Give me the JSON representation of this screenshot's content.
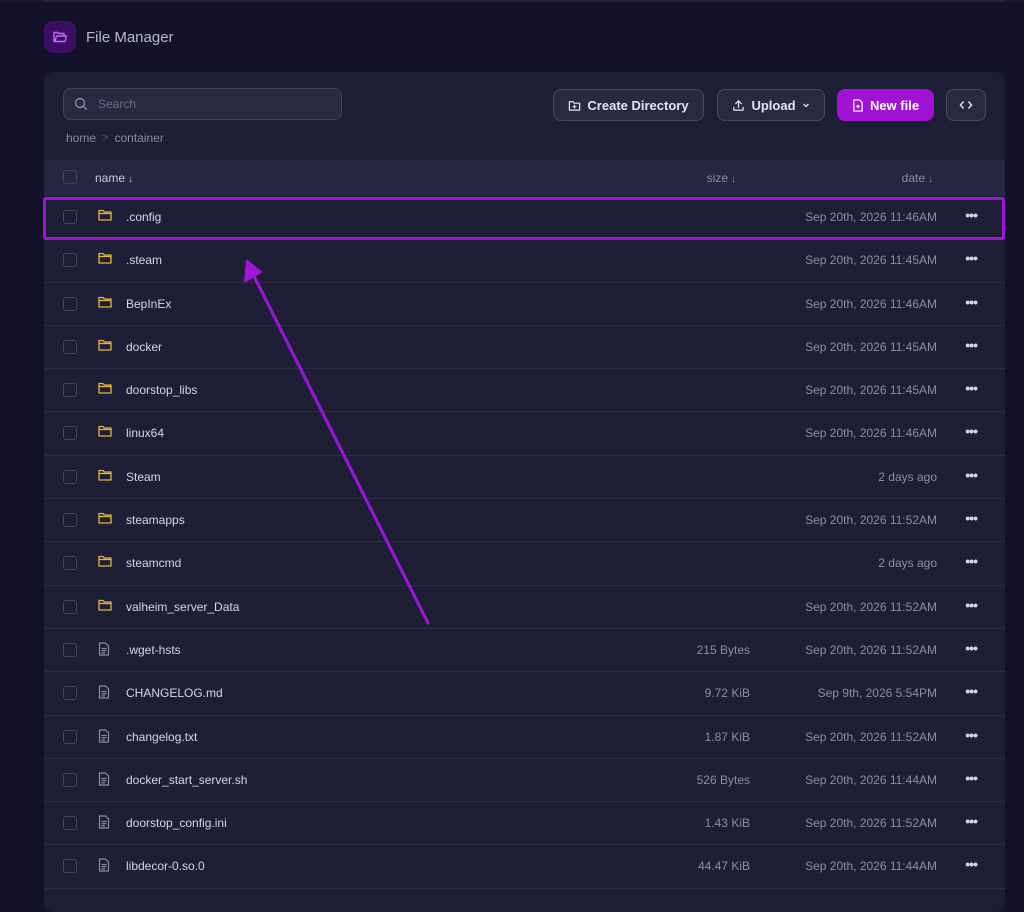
{
  "app": {
    "title": "File Manager"
  },
  "search": {
    "placeholder": "Search"
  },
  "toolbar": {
    "create_directory": "Create Directory",
    "upload": "Upload",
    "new_file": "New file"
  },
  "breadcrumb": [
    "home",
    "container"
  ],
  "columns": {
    "name": "name",
    "size": "size",
    "date": "date"
  },
  "sort_arrow": "↓",
  "files": [
    {
      "name": ".config",
      "type": "folder",
      "size": "",
      "date": "Sep 20th, 2026 11:46AM"
    },
    {
      "name": ".steam",
      "type": "folder",
      "size": "",
      "date": "Sep 20th, 2026 11:45AM"
    },
    {
      "name": "BepInEx",
      "type": "folder",
      "size": "",
      "date": "Sep 20th, 2026 11:46AM"
    },
    {
      "name": "docker",
      "type": "folder",
      "size": "",
      "date": "Sep 20th, 2026 11:45AM"
    },
    {
      "name": "doorstop_libs",
      "type": "folder",
      "size": "",
      "date": "Sep 20th, 2026 11:45AM"
    },
    {
      "name": "linux64",
      "type": "folder",
      "size": "",
      "date": "Sep 20th, 2026 11:46AM"
    },
    {
      "name": "Steam",
      "type": "folder",
      "size": "",
      "date": "2 days ago"
    },
    {
      "name": "steamapps",
      "type": "folder",
      "size": "",
      "date": "Sep 20th, 2026 11:52AM"
    },
    {
      "name": "steamcmd",
      "type": "folder",
      "size": "",
      "date": "2 days ago"
    },
    {
      "name": "valheim_server_Data",
      "type": "folder",
      "size": "",
      "date": "Sep 20th, 2026 11:52AM"
    },
    {
      "name": ".wget-hsts",
      "type": "file",
      "size": "215 Bytes",
      "date": "Sep 20th, 2026 11:52AM"
    },
    {
      "name": "CHANGELOG.md",
      "type": "file",
      "size": "9.72 KiB",
      "date": "Sep 9th, 2026 5:54PM"
    },
    {
      "name": "changelog.txt",
      "type": "file",
      "size": "1.87 KiB",
      "date": "Sep 20th, 2026 11:52AM"
    },
    {
      "name": "docker_start_server.sh",
      "type": "file",
      "size": "526 Bytes",
      "date": "Sep 20th, 2026 11:44AM"
    },
    {
      "name": "doorstop_config.ini",
      "type": "file",
      "size": "1.43 KiB",
      "date": "Sep 20th, 2026 11:52AM"
    },
    {
      "name": "libdecor-0.so.0",
      "type": "file",
      "size": "44.47 KiB",
      "date": "Sep 20th, 2026 11:44AM"
    }
  ],
  "colors": {
    "accent": "#a012d6",
    "folder": "#e2b93b",
    "annotation": "#a016d8"
  }
}
